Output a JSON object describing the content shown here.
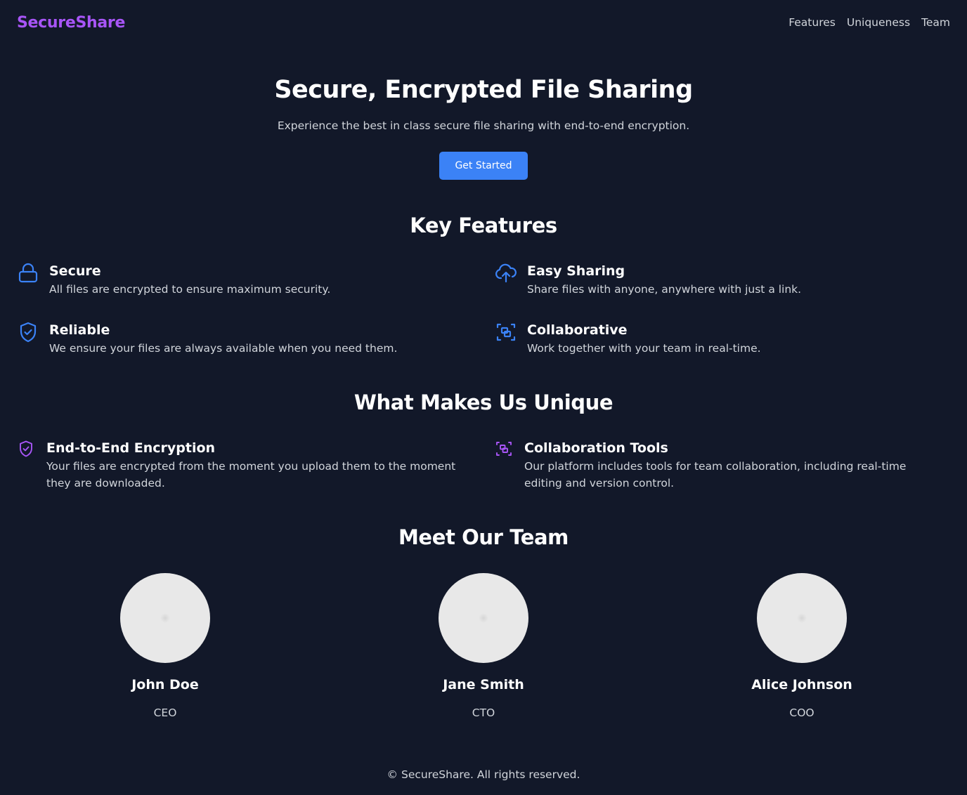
{
  "colors": {
    "background": "#121829",
    "brand": "#a855f7",
    "accent_blue": "#3b82f6",
    "accent_purple": "#a855f7",
    "muted_text": "#d1d5db"
  },
  "nav": {
    "brand": "SecureShare",
    "links": [
      "Features",
      "Uniqueness",
      "Team"
    ]
  },
  "hero": {
    "title": "Secure, Encrypted File Sharing",
    "subtitle": "Experience the best in class secure file sharing with end-to-end encryption.",
    "cta": "Get Started"
  },
  "features": {
    "title": "Key Features",
    "items": [
      {
        "icon": "lock-icon",
        "title": "Secure",
        "desc": "All files are encrypted to ensure maximum security."
      },
      {
        "icon": "cloud-upload-icon",
        "title": "Easy Sharing",
        "desc": "Share files with anyone, anywhere with just a link."
      },
      {
        "icon": "shield-check-icon",
        "title": "Reliable",
        "desc": "We ensure your files are always available when you need them."
      },
      {
        "icon": "group-icon",
        "title": "Collaborative",
        "desc": "Work together with your team in real-time."
      }
    ]
  },
  "uniqueness": {
    "title": "What Makes Us Unique",
    "items": [
      {
        "icon": "shield-check-icon",
        "title": "End-to-End Encryption",
        "desc": "Your files are encrypted from the moment you upload them to the moment they are downloaded."
      },
      {
        "icon": "group-icon",
        "title": "Collaboration Tools",
        "desc": "Our platform includes tools for team collaboration, including real-time editing and version control."
      }
    ]
  },
  "team": {
    "title": "Meet Our Team",
    "members": [
      {
        "name": "John Doe",
        "role": "CEO"
      },
      {
        "name": "Jane Smith",
        "role": "CTO"
      },
      {
        "name": "Alice Johnson",
        "role": "COO"
      }
    ]
  },
  "footer": {
    "text": "© SecureShare. All rights reserved."
  }
}
